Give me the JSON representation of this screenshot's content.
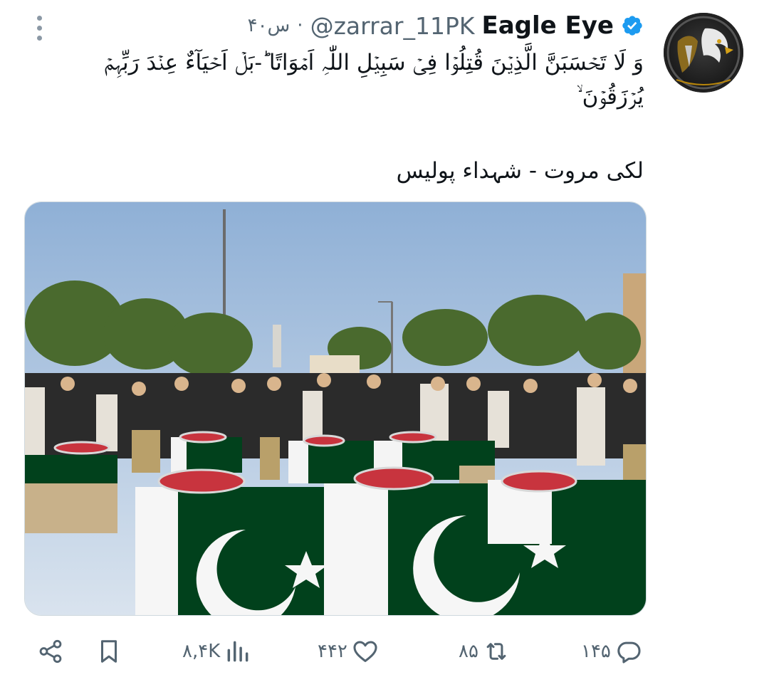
{
  "author": {
    "name": "Eagle Eye",
    "handle": "@zarrar_11PK",
    "time": "۴۰س",
    "separator": "·",
    "verified": true,
    "avatar_icon": "eagle-avatar"
  },
  "tweet": {
    "verse": "وَ لَا تَحۡسَبَنَّ الَّذِیۡنَ قُتِلُوۡا فِیۡ سَبِیۡلِ اللّٰہِ اَمۡوَاتًا ؕ-بَلۡ اَحۡیَآءٌ عِنۡدَ رَبِّہِمۡ یُرۡزَقُوۡنَ ۙ",
    "subtitle": "لکی مروت - شہداء پولیس",
    "image_icon": "funeral-photo"
  },
  "actions": {
    "reply_count": "۱۴۵",
    "retweet_count": "۸۵",
    "like_count": "۴۴۲",
    "views_count": "۸,۴K",
    "icons": [
      "reply-icon",
      "retweet-icon",
      "like-icon",
      "views-icon",
      "bookmark-icon",
      "share-icon"
    ]
  },
  "colors": {
    "verified": "#1d9bf0",
    "secondary_text": "#536471",
    "flag_green": "#01411c"
  }
}
